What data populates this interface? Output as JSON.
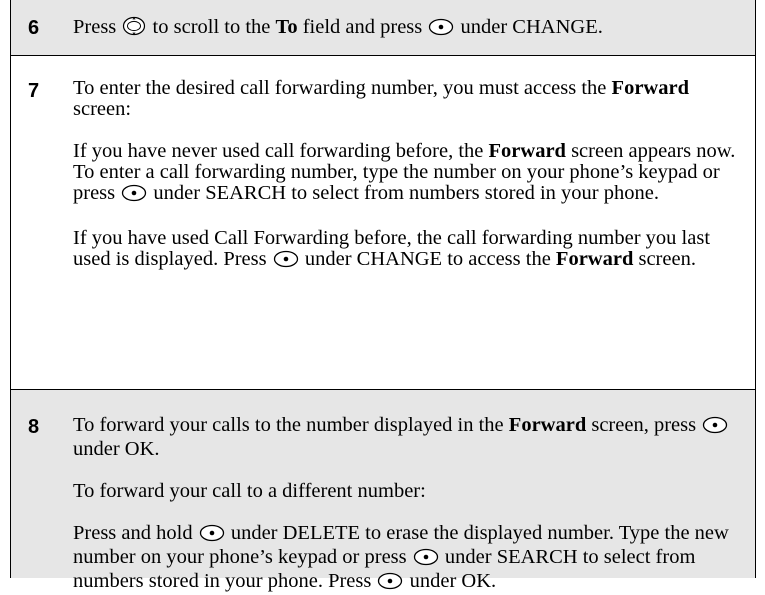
{
  "steps": [
    {
      "number": "6",
      "paragraphs": [
        [
          {
            "t": "Press "
          },
          {
            "icon": "scroll-key-icon"
          },
          {
            "t": " to scroll to the "
          },
          {
            "b": "To"
          },
          {
            "t": " field and press "
          },
          {
            "icon": "softkey-button-icon"
          },
          {
            "t": " under CHANGE."
          }
        ]
      ]
    },
    {
      "number": "7",
      "paragraphs": [
        [
          {
            "t": "To enter the desired call forwarding number, you must access the "
          },
          {
            "b": "Forward"
          },
          {
            "t": " screen:"
          }
        ],
        [
          {
            "t": "If you have never used call forwarding before, the "
          },
          {
            "b": "Forward"
          },
          {
            "t": " screen appears now. To enter a call forwarding number, type the number on your phone’s keypad or press "
          },
          {
            "icon": "softkey-button-icon"
          },
          {
            "t": " under SEARCH to select from numbers stored in your phone."
          }
        ],
        [
          {
            "t": "If you have used Call Forwarding before, the call forwarding number you last used is displayed. Press "
          },
          {
            "icon": "softkey-button-icon"
          },
          {
            "t": " under CHANGE to access the "
          },
          {
            "b": "Forward"
          },
          {
            "t": " screen."
          }
        ]
      ]
    },
    {
      "number": "8",
      "paragraphs": [
        [
          {
            "t": "To forward your calls to the number displayed in the "
          },
          {
            "b": "Forward"
          },
          {
            "t": " screen, press "
          },
          {
            "icon": "softkey-button-icon"
          },
          {
            "t": " under OK."
          }
        ],
        [
          {
            "t": "To forward your call to a different number:"
          }
        ],
        [
          {
            "t": "Press and hold "
          },
          {
            "icon": "softkey-button-icon"
          },
          {
            "t": " under DELETE to erase the displayed number. Type the new number on your phone’s keypad or press "
          },
          {
            "icon": "softkey-button-icon"
          },
          {
            "t": " under SEARCH to select from numbers stored in your phone. Press "
          },
          {
            "icon": "softkey-button-icon"
          },
          {
            "t": " under OK."
          }
        ]
      ]
    }
  ],
  "colors": {
    "shade": "#e6e6e6",
    "rule": "#000000"
  }
}
